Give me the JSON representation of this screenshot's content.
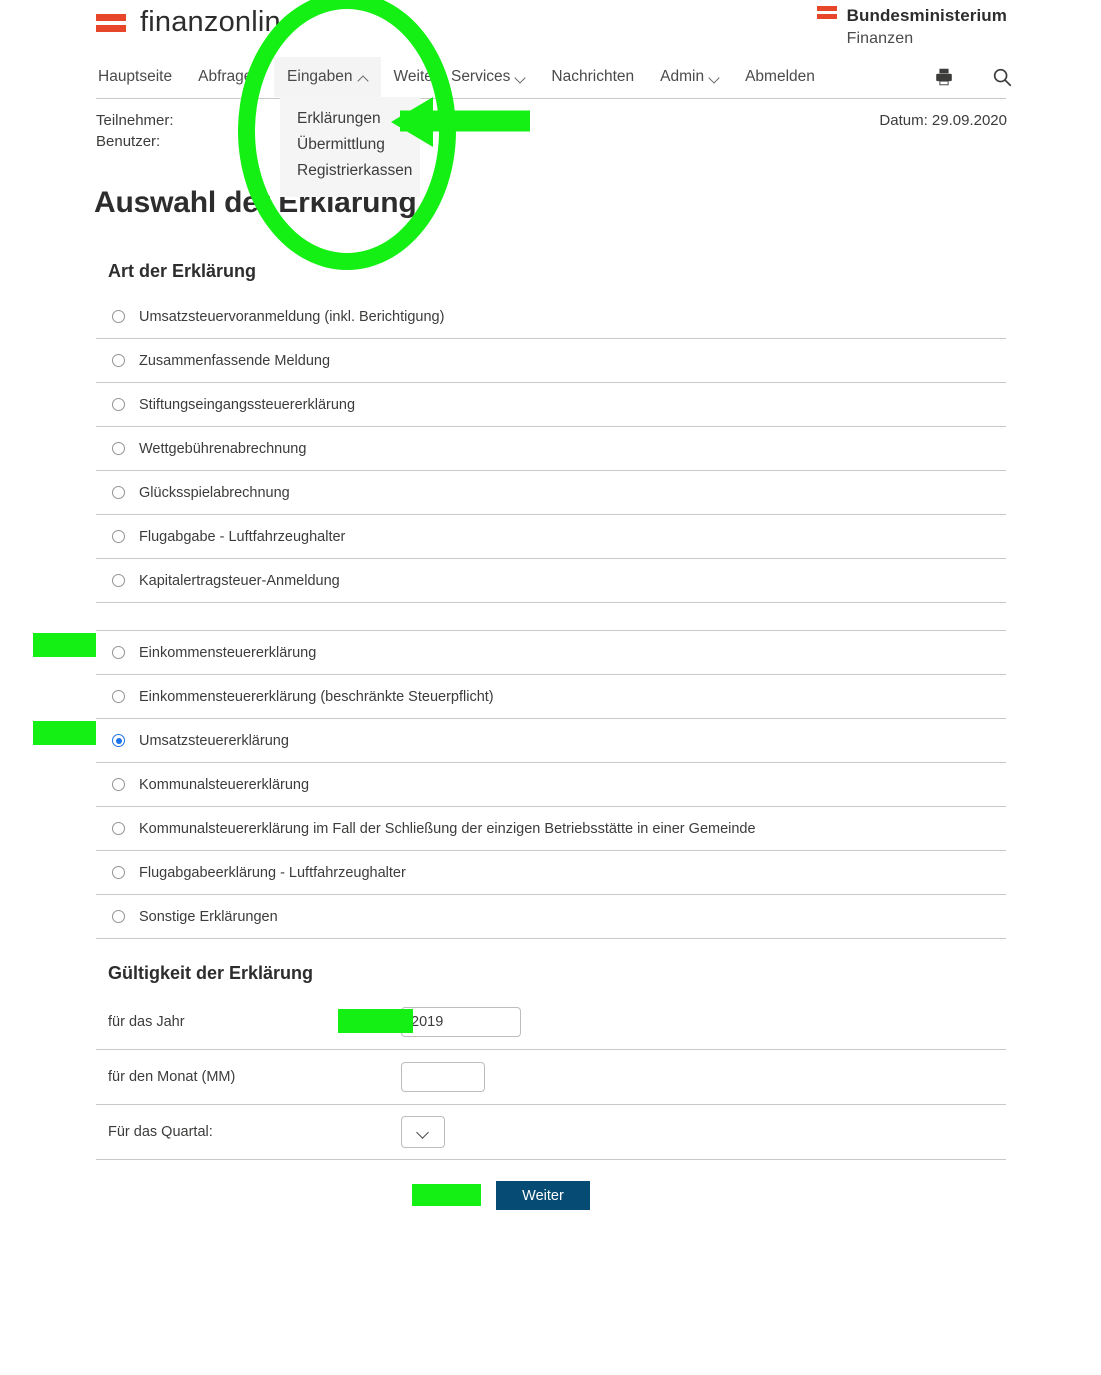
{
  "brand": {
    "logo_text": "finanzonline",
    "flag_icon": "austria-flag-icon",
    "ministry_line1": "Bundesministerium",
    "ministry_line2": "Finanzen"
  },
  "nav": {
    "items": [
      {
        "label": "Hauptseite",
        "chevron": "none",
        "open": false
      },
      {
        "label": "Abfragen",
        "chevron": "none",
        "open": false
      },
      {
        "label": "Eingaben",
        "chevron": "up",
        "open": true
      },
      {
        "label": "Weitere Services",
        "chevron": "down",
        "open": false
      },
      {
        "label": "Nachrichten",
        "chevron": "none",
        "open": false
      },
      {
        "label": "Admin",
        "chevron": "down",
        "open": false
      },
      {
        "label": "Abmelden",
        "chevron": "none",
        "open": false
      }
    ],
    "icons": [
      {
        "name": "print-icon"
      },
      {
        "name": "search-icon"
      }
    ]
  },
  "dropdown": {
    "open_for": "Eingaben",
    "items": [
      {
        "label": "Erklärungen"
      },
      {
        "label": "Übermittlung"
      },
      {
        "label": "Registrierkassen"
      }
    ]
  },
  "meta": {
    "teilnehmer_label": "Teilnehmer:",
    "teilnehmer_value": "",
    "benutzer_label": "Benutzer:",
    "benutzer_value": "",
    "date": "Datum: 29.09.2020"
  },
  "page": {
    "title": "Auswahl der Erklärung"
  },
  "sections": {
    "art": {
      "heading": "Art der Erklärung",
      "options": [
        {
          "label": "Umsatzsteuervoranmeldung (inkl. Berichtigung)",
          "checked": false,
          "spacer": false,
          "marked": false
        },
        {
          "label": "Zusammenfassende Meldung",
          "checked": false,
          "spacer": false,
          "marked": false
        },
        {
          "label": "Stiftungseingangssteuererklärung",
          "checked": false,
          "spacer": false,
          "marked": false
        },
        {
          "label": "Wettgebührenabrechnung",
          "checked": false,
          "spacer": false,
          "marked": false
        },
        {
          "label": "Glücksspielabrechnung",
          "checked": false,
          "spacer": false,
          "marked": false
        },
        {
          "label": "Flugabgabe - Luftfahrzeughalter",
          "checked": false,
          "spacer": false,
          "marked": false
        },
        {
          "label": "Kapitalertragsteuer-Anmeldung",
          "checked": false,
          "spacer": false,
          "marked": false
        },
        {
          "label": "",
          "checked": false,
          "spacer": true,
          "marked": false
        },
        {
          "label": "Einkommensteuererklärung",
          "checked": false,
          "spacer": false,
          "marked": true
        },
        {
          "label": "Einkommensteuererklärung (beschränkte Steuerpflicht)",
          "checked": false,
          "spacer": false,
          "marked": false
        },
        {
          "label": "Umsatzsteuererklärung",
          "checked": true,
          "spacer": false,
          "marked": true
        },
        {
          "label": "Kommunalsteuererklärung",
          "checked": false,
          "spacer": false,
          "marked": false
        },
        {
          "label": "Kommunalsteuererklärung im Fall der Schließung der einzigen Betriebsstätte in einer Gemeinde",
          "checked": false,
          "spacer": false,
          "marked": false
        },
        {
          "label": "Flugabgabeerklärung - Luftfahrzeughalter",
          "checked": false,
          "spacer": false,
          "marked": false
        },
        {
          "label": "Sonstige Erklärungen",
          "checked": false,
          "spacer": false,
          "marked": false
        }
      ]
    },
    "gueltigkeit": {
      "heading": "Gültigkeit der Erklärung",
      "year": {
        "label": "für das Jahr",
        "value": "2019",
        "placeholder": ""
      },
      "month": {
        "label": "für den Monat (MM)",
        "value": "",
        "placeholder": ""
      },
      "quarter": {
        "label": "Für das Quartal:",
        "value": "",
        "options": [
          ""
        ]
      }
    }
  },
  "actions": {
    "weiter_label": "Weiter"
  },
  "annotations": {
    "accent_color": "#14f014",
    "shapes": [
      {
        "name": "highlight-ellipse-eingaben-menu"
      },
      {
        "name": "arrow-pointing-to-erklaerungen"
      },
      {
        "name": "highlight-bar-einkommensteuererklaerung"
      },
      {
        "name": "highlight-bar-umsatzsteuererklaerung"
      },
      {
        "name": "highlight-bar-jahr-field"
      },
      {
        "name": "highlight-bar-weiter-button"
      }
    ]
  }
}
